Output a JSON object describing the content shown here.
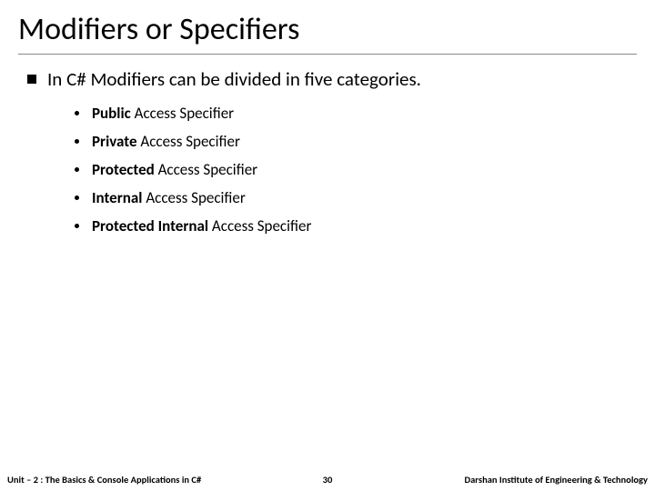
{
  "title": "Modifiers or Specifiers",
  "main_bullet": "In C# Modifiers can be divided in five categories.",
  "items": [
    {
      "bold": "Public",
      "rest": " Access Specifier"
    },
    {
      "bold": "Private",
      "rest": " Access Specifier"
    },
    {
      "bold": "Protected",
      "rest": " Access Specifier"
    },
    {
      "bold": "Internal",
      "rest": " Access Specifier"
    },
    {
      "bold": "Protected Internal",
      "rest": " Access Specifier"
    }
  ],
  "footer": {
    "left": "Unit – 2 : The Basics & Console Applications in C#",
    "page": "30",
    "right": "Darshan Institute of Engineering & Technology"
  }
}
